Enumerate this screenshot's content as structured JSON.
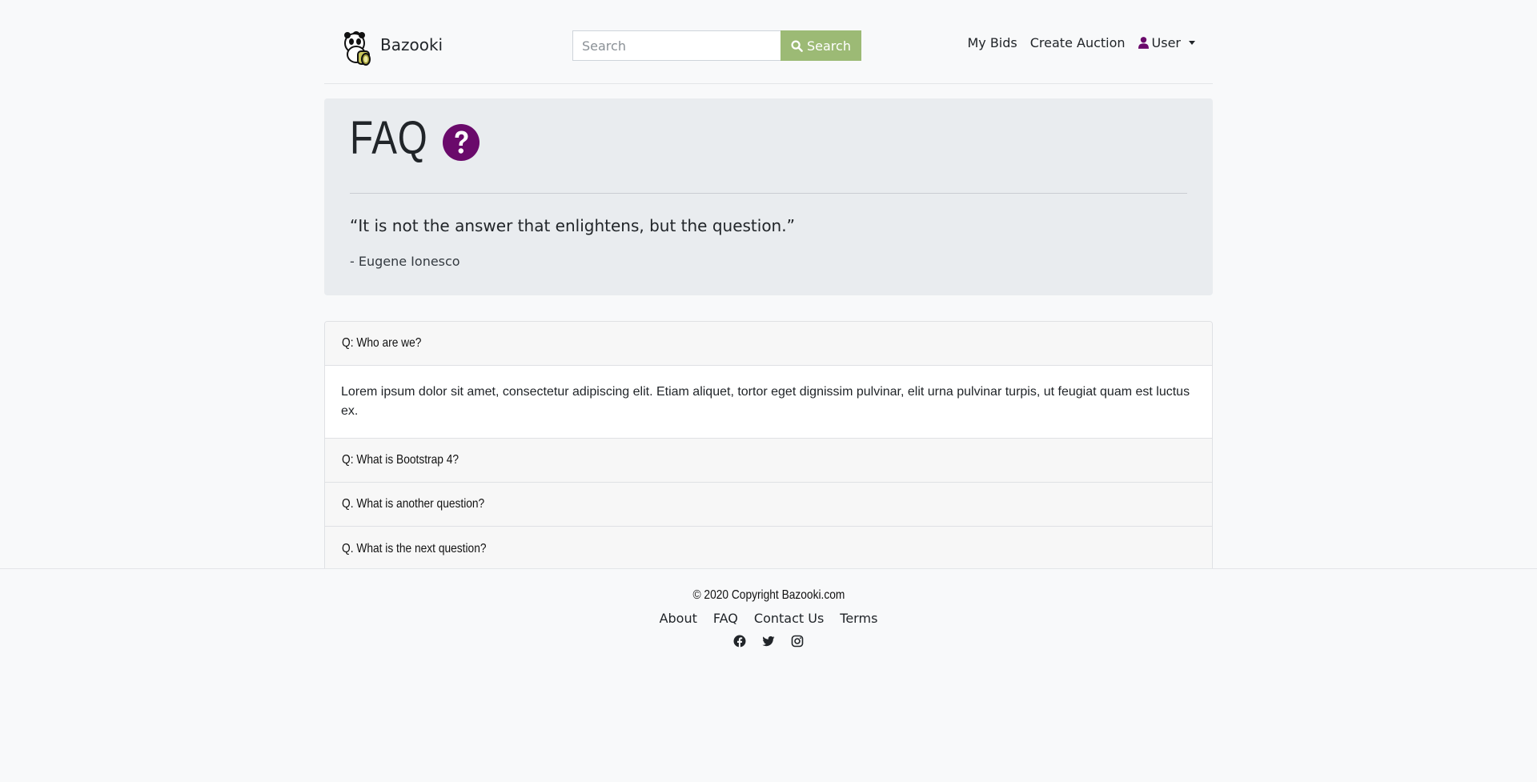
{
  "brand": {
    "name": "Bazooki",
    "logo_icon": "panda-logo-icon"
  },
  "search": {
    "placeholder": "Search",
    "button_label": "Search",
    "button_icon": "search-icon",
    "button_color": "#9cba75"
  },
  "nav": {
    "links": [
      {
        "label": "My Bids"
      },
      {
        "label": "Create Auction"
      }
    ],
    "user": {
      "label": "User",
      "icon": "user-icon",
      "icon_color": "#6a0a6b"
    }
  },
  "jumbotron": {
    "title": "FAQ",
    "title_icon": "question-circle-icon",
    "title_icon_color": "#6a0a6b",
    "quote": "“It is not the answer that enlightens, but the question.”",
    "author": "- Eugene Ionesco"
  },
  "faq": {
    "items": [
      {
        "question": "Q: Who are we?",
        "answer": "Lorem ipsum dolor sit amet, consectetur adipiscing elit. Etiam aliquet, tortor eget dignissim pulvinar, elit urna pulvinar turpis, ut feugiat quam est luctus ex.",
        "expanded": true
      },
      {
        "question": "Q: What is Bootstrap 4?",
        "expanded": false
      },
      {
        "question": "Q. What is another question?",
        "expanded": false
      },
      {
        "question": "Q. What is the next question?",
        "expanded": false
      }
    ]
  },
  "footer": {
    "copyright": "© 2020 Copyright Bazooki.com",
    "links": [
      {
        "label": "About"
      },
      {
        "label": "FAQ"
      },
      {
        "label": "Contact Us"
      },
      {
        "label": "Terms"
      }
    ],
    "social": [
      "facebook-icon",
      "twitter-icon",
      "instagram-icon"
    ]
  }
}
